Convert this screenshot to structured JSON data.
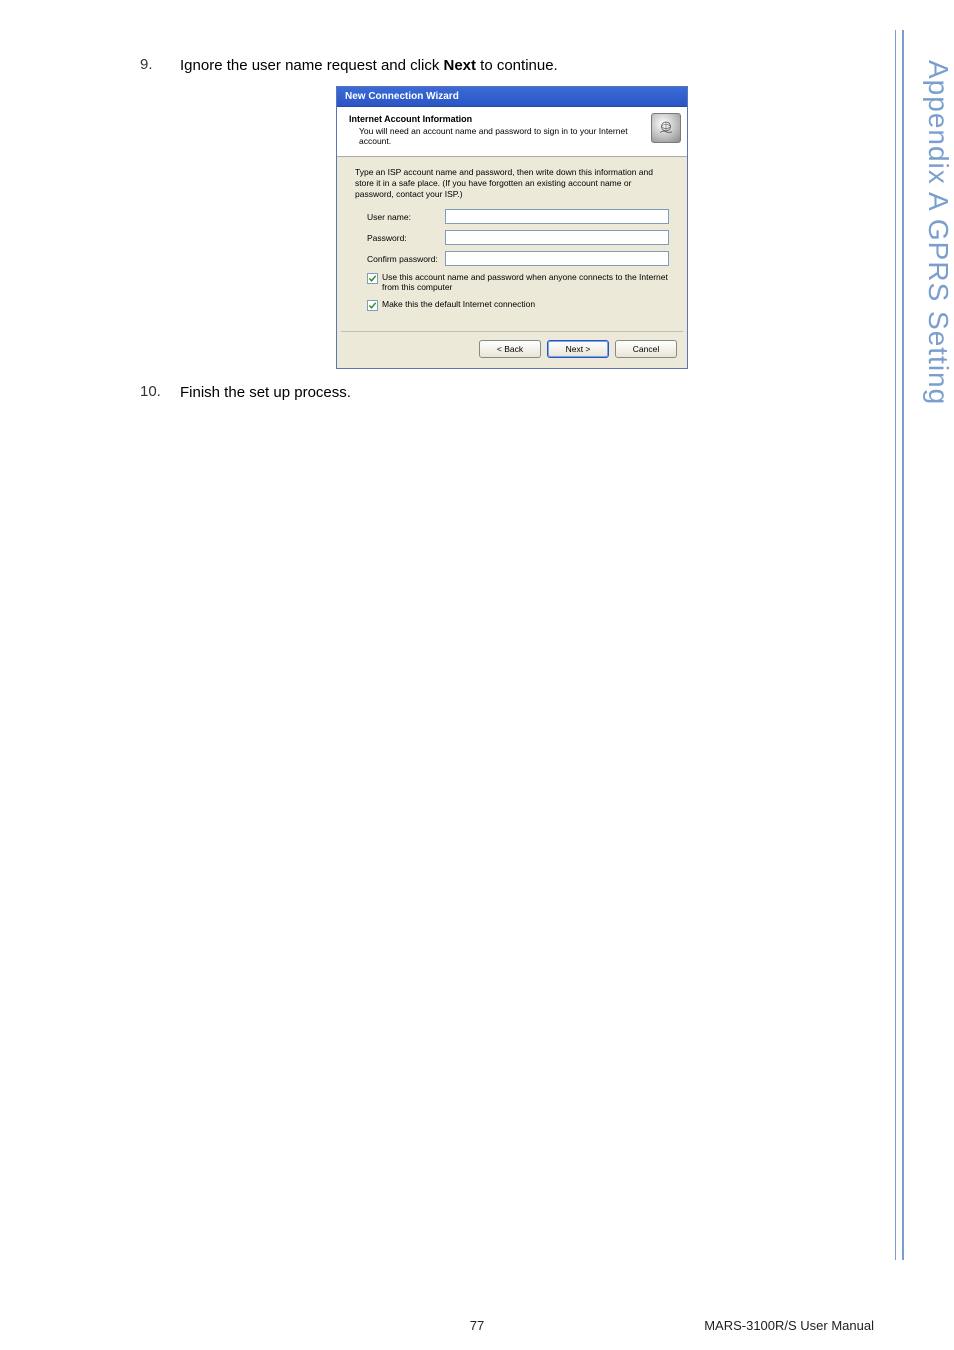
{
  "side_label": "Appendix A  GPRS Setting",
  "steps": {
    "nine": {
      "num": "9.",
      "pre": "Ignore the user name request and click ",
      "bold": "Next",
      "post": " to continue."
    },
    "ten": {
      "num": "10.",
      "text": "Finish the set up process."
    }
  },
  "dialog": {
    "title": "New Connection Wizard",
    "header_title": "Internet Account Information",
    "header_sub": "You will need an account name and password to sign in to your Internet account.",
    "icon_name": "wizard-icon",
    "instructions": "Type an ISP account name and password, then write down this information and store it in a safe place. (If you have forgotten an existing account name or password, contact your ISP.)",
    "fields": {
      "username_label": "User name:",
      "username_value": "",
      "password_label": "Password:",
      "password_value": "",
      "confirm_label": "Confirm password:",
      "confirm_value": ""
    },
    "check1": "Use this account  name and password when anyone connects to the Internet from this computer",
    "check2": "Make this the default Internet connection",
    "buttons": {
      "back": "< Back",
      "next": "Next >",
      "cancel": "Cancel"
    }
  },
  "footer": {
    "page_number": "77",
    "manual": "MARS-3100R/S User Manual"
  }
}
